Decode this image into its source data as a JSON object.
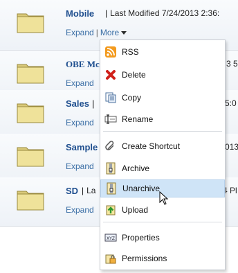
{
  "rows": [
    {
      "name": "Mobile",
      "meta": "Last Modified 7/24/2013 2:36:",
      "expand": "Expand",
      "more": "More"
    },
    {
      "name": "OBE Mc",
      "meta": "3 5:",
      "expand": "Expand"
    },
    {
      "name": "Sales",
      "meta": "5:0",
      "expand": "Expand"
    },
    {
      "name": "Sample",
      "meta": "013",
      "expand": "Expand"
    },
    {
      "name": "SD",
      "meta": "La",
      "meta_right": "4 Pl",
      "expand": "Expand"
    }
  ],
  "menu": {
    "items": [
      {
        "label": "RSS",
        "icon": "rss-icon"
      },
      {
        "label": "Delete",
        "icon": "delete-x-icon"
      },
      {
        "label": "Copy",
        "icon": "copy-icon"
      },
      {
        "label": "Rename",
        "icon": "rename-icon"
      },
      {
        "label": "Create Shortcut",
        "icon": "shortcut-icon"
      },
      {
        "label": "Archive",
        "icon": "archive-icon"
      },
      {
        "label": "Unarchive",
        "icon": "unarchive-icon",
        "highlighted": true
      },
      {
        "label": "Upload",
        "icon": "upload-icon"
      },
      {
        "label": "Properties",
        "icon": "properties-icon"
      },
      {
        "label": "Permissions",
        "icon": "permissions-icon"
      }
    ]
  },
  "colors": {
    "link": "#3a6ea5",
    "title": "#1f4f8f",
    "highlight": "#cfe4f7"
  }
}
